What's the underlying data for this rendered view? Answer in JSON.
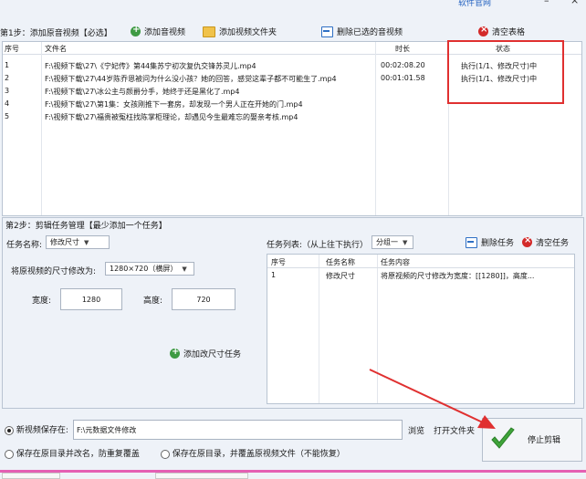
{
  "top": {
    "link": "软件官网",
    "min": "–",
    "close": "×"
  },
  "step1": {
    "label": "第1步：添加原音视频【必选】",
    "buttons": {
      "add_video": "添加音视频",
      "add_folder": "添加视频文件夹",
      "delete_selected": "删除已选的音视频",
      "clear_table": "清空表格"
    },
    "table": {
      "headers": {
        "no": "序号",
        "name": "文件名",
        "duration": "时长",
        "status": "状态"
      },
      "rows": [
        {
          "no": "1",
          "name": "F:\\视频下载\\27\\《宁妃传》第44集苏宁初次复仇交锋苏灵儿.mp4",
          "duration": "00:02:08.20",
          "status": "执行(1/1、修改尺寸)中"
        },
        {
          "no": "2",
          "name": "F:\\视频下载\\27\\44岁陈乔恩被问为什么没小孩？她的回答，感觉这辈子都不可能生了.mp4",
          "duration": "00:01:01.58",
          "status": "执行(1/1、修改尺寸)中"
        },
        {
          "no": "3",
          "name": "F:\\视频下载\\27\\冰公主与颜爵分手，她终于还是黑化了.mp4",
          "duration": "",
          "status": ""
        },
        {
          "no": "4",
          "name": "F:\\视频下载\\27\\第1集：女孩刚推下一套房，却发现一个男人正在开她的门.mp4",
          "duration": "",
          "status": ""
        },
        {
          "no": "5",
          "name": "F:\\视频下载\\27\\福贵被冤枉找陈掌柜理论，却遇见今生最难忘的娶亲考核.mp4",
          "duration": "",
          "status": ""
        }
      ]
    }
  },
  "step2": {
    "label": "第2步：剪辑任务管理【最少添加一个任务】",
    "task_name_label": "任务名称:",
    "task_name_value": "修改尺寸",
    "size_label": "将原视频的尺寸修改为:",
    "size_value": "1280×720（横屏）",
    "width_label": "宽度:",
    "width_value": "1280",
    "height_label": "高度:",
    "height_value": "720",
    "add_task_button": "添加改尺寸任务",
    "task_list_label": "任务列表:（从上往下执行）",
    "group_value": "分组一",
    "delete_task_button": "删除任务",
    "clear_tasks_button": "清空任务",
    "task_table": {
      "headers": {
        "no": "序号",
        "name": "任务名称",
        "content": "任务内容"
      },
      "rows": [
        {
          "no": "1",
          "name": "修改尺寸",
          "content": "将原视频的尺寸修改为宽度：[[1280]]，高度..."
        }
      ]
    }
  },
  "output": {
    "new_save_label": "新视频保存在:",
    "path_value": "F:\\元数据文件修改",
    "browse": "浏览",
    "open_folder": "打开文件夹",
    "option1": "保存在原目录并改名，防重复覆盖",
    "option2": "保存在原目录，并覆盖原视频文件（不能恢复）",
    "stop_button": "停止剪辑"
  },
  "colors": {
    "accent_red": "#e03030",
    "pink_bar": "#e45fb3",
    "check_green": "#3fa43a"
  }
}
